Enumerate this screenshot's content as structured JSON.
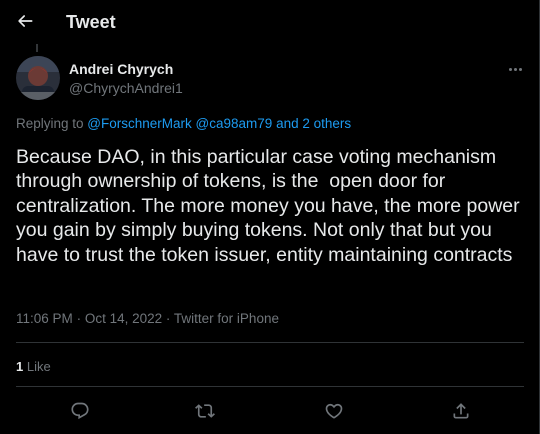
{
  "header": {
    "title": "Tweet"
  },
  "author": {
    "name": "Andrei Chyrych",
    "handle": "@ChyrychAndrei1"
  },
  "reply": {
    "prefix": "Replying to ",
    "mention1": "@ForschnerMark",
    "mention2": "@ca98am79",
    "joiner": "and",
    "others": "2 others"
  },
  "tweet": {
    "text": "Because DAO, in this particular case voting mechanism through ownership of tokens, is the  open door for centralization. The more money you have, the more power you gain by simply buying tokens. Not only that but you have to trust the token issuer, entity maintaining contracts",
    "time": "11:06 PM",
    "separator": "·",
    "date": "Oct 14, 2022",
    "source": "Twitter for iPhone"
  },
  "stats": {
    "likes_count": "1",
    "likes_label": "Like"
  },
  "actions": {
    "icons": [
      "reply-icon",
      "retweet-icon",
      "like-icon",
      "share-icon"
    ]
  },
  "colors": {
    "background": "#000000",
    "text": "#e7e9ea",
    "secondary": "#71767b",
    "accent": "#1d9bf0",
    "border": "#2f3336"
  }
}
